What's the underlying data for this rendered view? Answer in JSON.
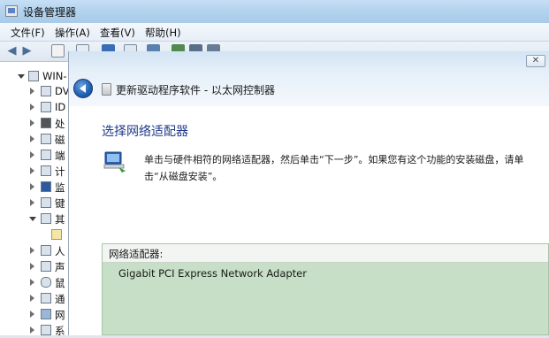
{
  "device_manager": {
    "title": "设备管理器",
    "menu": [
      "文件(F)",
      "操作(A)",
      "查看(V)",
      "帮助(H)"
    ],
    "tree": [
      {
        "label": "WIN-",
        "expanded": true,
        "icon": "computer-icon"
      },
      {
        "label": "DV",
        "icon": "dvd-drive-icon"
      },
      {
        "label": "ID",
        "icon": "ide-controller-icon"
      },
      {
        "label": "处",
        "icon": "processor-icon"
      },
      {
        "label": "磁",
        "icon": "disk-drive-icon"
      },
      {
        "label": "端",
        "icon": "port-icon"
      },
      {
        "label": "计",
        "icon": "computer-icon"
      },
      {
        "label": "监",
        "icon": "monitor-icon"
      },
      {
        "label": "键",
        "icon": "keyboard-icon"
      },
      {
        "label": "其",
        "expanded": true,
        "icon": "other-devices-icon"
      },
      {
        "label": "",
        "icon": "unknown-device-icon"
      },
      {
        "label": "人",
        "icon": "hid-icon"
      },
      {
        "label": "声",
        "icon": "sound-icon"
      },
      {
        "label": "鼠",
        "icon": "mouse-icon"
      },
      {
        "label": "通",
        "icon": "usb-icon"
      },
      {
        "label": "网",
        "icon": "network-adapter-icon"
      },
      {
        "label": "系",
        "icon": "system-device-icon"
      }
    ]
  },
  "wizard": {
    "title": "更新驱动程序软件 - 以太网控制器",
    "close_label": "✕",
    "heading": "选择网络适配器",
    "description": "单击与硬件相符的网络适配器，然后单击“下一步”。如果您有这个功能的安装磁盘，请单击“从磁盘安装”。",
    "list_header": "网络适配器:",
    "adapters": [
      "Gigabit PCI Express Network Adapter"
    ]
  },
  "colors": {
    "heading": "#1e3a8a",
    "list_bg": "#c6dfc6",
    "titlebar": "#b4d3ee"
  }
}
